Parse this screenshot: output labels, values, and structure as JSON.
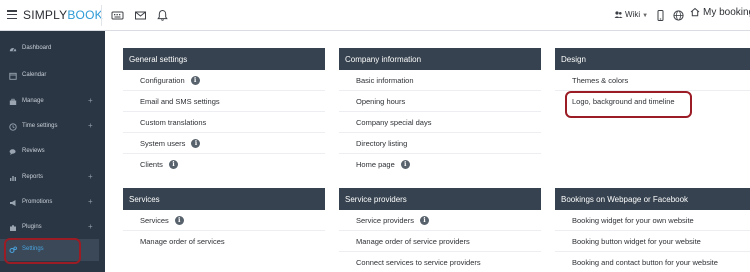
{
  "app": {
    "logo_part1": "SIMPLY",
    "logo_part2": "BOOK",
    "wiki_label": "Wiki",
    "site_label": "My booking s"
  },
  "sidebar": {
    "items": [
      {
        "label": "Dashboard",
        "icon": "gauge-icon",
        "has_plus": false
      },
      {
        "label": "Calendar",
        "icon": "calendar-icon",
        "has_plus": false
      },
      {
        "label": "Manage",
        "icon": "briefcase-icon",
        "has_plus": true
      },
      {
        "label": "Time settings",
        "icon": "clock-icon",
        "has_plus": true
      },
      {
        "label": "Reviews",
        "icon": "comments-icon",
        "has_plus": false
      },
      {
        "label": "Reports",
        "icon": "bar-chart-icon",
        "has_plus": true
      },
      {
        "label": "Promotions",
        "icon": "megaphone-icon",
        "has_plus": true
      },
      {
        "label": "Plugins",
        "icon": "puzzle-icon",
        "has_plus": true
      },
      {
        "label": "Settings",
        "icon": "cogs-icon",
        "has_plus": false,
        "active": true
      }
    ],
    "plus_symbol": "+"
  },
  "panels": {
    "general": {
      "title": "General settings",
      "rows": [
        "Configuration",
        "Email and SMS settings",
        "Custom translations",
        "System users",
        "Clients"
      ]
    },
    "company": {
      "title": "Company information",
      "rows": [
        "Basic information",
        "Opening hours",
        "Company special days",
        "Directory listing",
        "Home page"
      ]
    },
    "design": {
      "title": "Design",
      "rows": [
        "Themes & colors",
        "Logo, background and timeline"
      ]
    },
    "services": {
      "title": "Services",
      "rows": [
        "Services",
        "Manage order of services"
      ]
    },
    "providers": {
      "title": "Service providers",
      "rows": [
        "Service providers",
        "Manage order of service providers",
        "Connect services to service providers"
      ]
    },
    "bookings": {
      "title": "Bookings on Webpage or Facebook",
      "rows": [
        "Booking widget for your own website",
        "Booking button widget for your website",
        "Booking and contact button for your website"
      ]
    }
  },
  "info_glyph": "i",
  "colors": {
    "sidebar_bg": "#2a3644",
    "panel_header_bg": "#36424f",
    "accent": "#2e9bd6",
    "highlight_outline": "#9b1c24"
  }
}
